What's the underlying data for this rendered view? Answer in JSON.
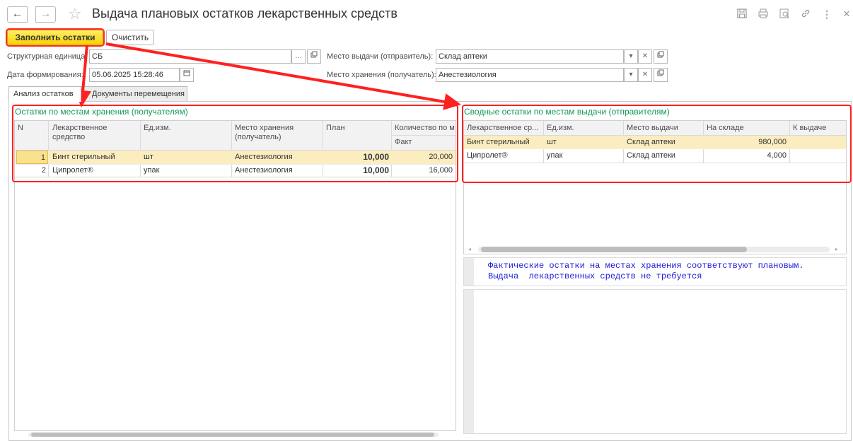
{
  "header": {
    "back_icon": "←",
    "forward_icon": "→",
    "star_icon": "☆",
    "title": "Выдача плановых остатков лекарственных средств",
    "actions": [
      "save-icon",
      "print-icon",
      "preview-icon",
      "link-icon",
      "more-icon",
      "close-icon"
    ]
  },
  "toolbar": {
    "fill_label": "Заполнить остатки",
    "clear_label": "Очистить"
  },
  "form": {
    "unit_label": "Структурная единица:",
    "unit_value": "СБ",
    "date_label": "Дата формирования:",
    "date_value": "05.06.2025 15:28:46",
    "issue_place_label": "Место выдачи (отправитель):",
    "issue_place_value": "Склад аптеки",
    "storage_place_label": "Место хранения (получатель):",
    "storage_place_value": "Анестезиология"
  },
  "tabs": [
    {
      "label": "Анализ остатков"
    },
    {
      "label": "Документы перемещения"
    }
  ],
  "left_section": {
    "title": "Остатки по местам хранения (получателям)",
    "columns": {
      "n": "N",
      "drug": "Лекарственное средство",
      "unit": "Ед.изм.",
      "storage": "Место хранения (получатель)",
      "plan": "План",
      "qty": "Количество по  м",
      "fact": "Факт"
    },
    "rows": [
      {
        "n": "1",
        "drug": "Бинт стерильный",
        "unit": "шт",
        "storage": "Анестезиология",
        "plan": "10,000",
        "fact": "20,000"
      },
      {
        "n": "2",
        "drug": "Ципролет®",
        "unit": "упак",
        "storage": "Анестезиология",
        "plan": "10,000",
        "fact": "16,000"
      }
    ]
  },
  "right_section": {
    "title": "Сводные остатки по местам выдачи (отправителям)",
    "columns": {
      "drug": "Лекарственное ср...",
      "unit": "Ед.изм.",
      "place": "Место выдачи",
      "stock": "На складе",
      "issue": "К выдаче"
    },
    "rows": [
      {
        "drug": "Бинт стерильный",
        "unit": "шт",
        "place": "Склад аптеки",
        "stock": "980,000",
        "issue": ""
      },
      {
        "drug": "Ципролет®",
        "unit": "упак",
        "place": "Склад аптеки",
        "stock": "4,000",
        "issue": ""
      }
    ]
  },
  "message": {
    "line1": "Фактические остатки на местах хранения соответствуют плановым.",
    "line2": "Выдача  лекарственных средств не требуется"
  },
  "colors": {
    "accent_button": "#f5d300",
    "section_title": "#14985a",
    "message_text": "#1a1ad8",
    "annotation_red": "#ff2020"
  }
}
